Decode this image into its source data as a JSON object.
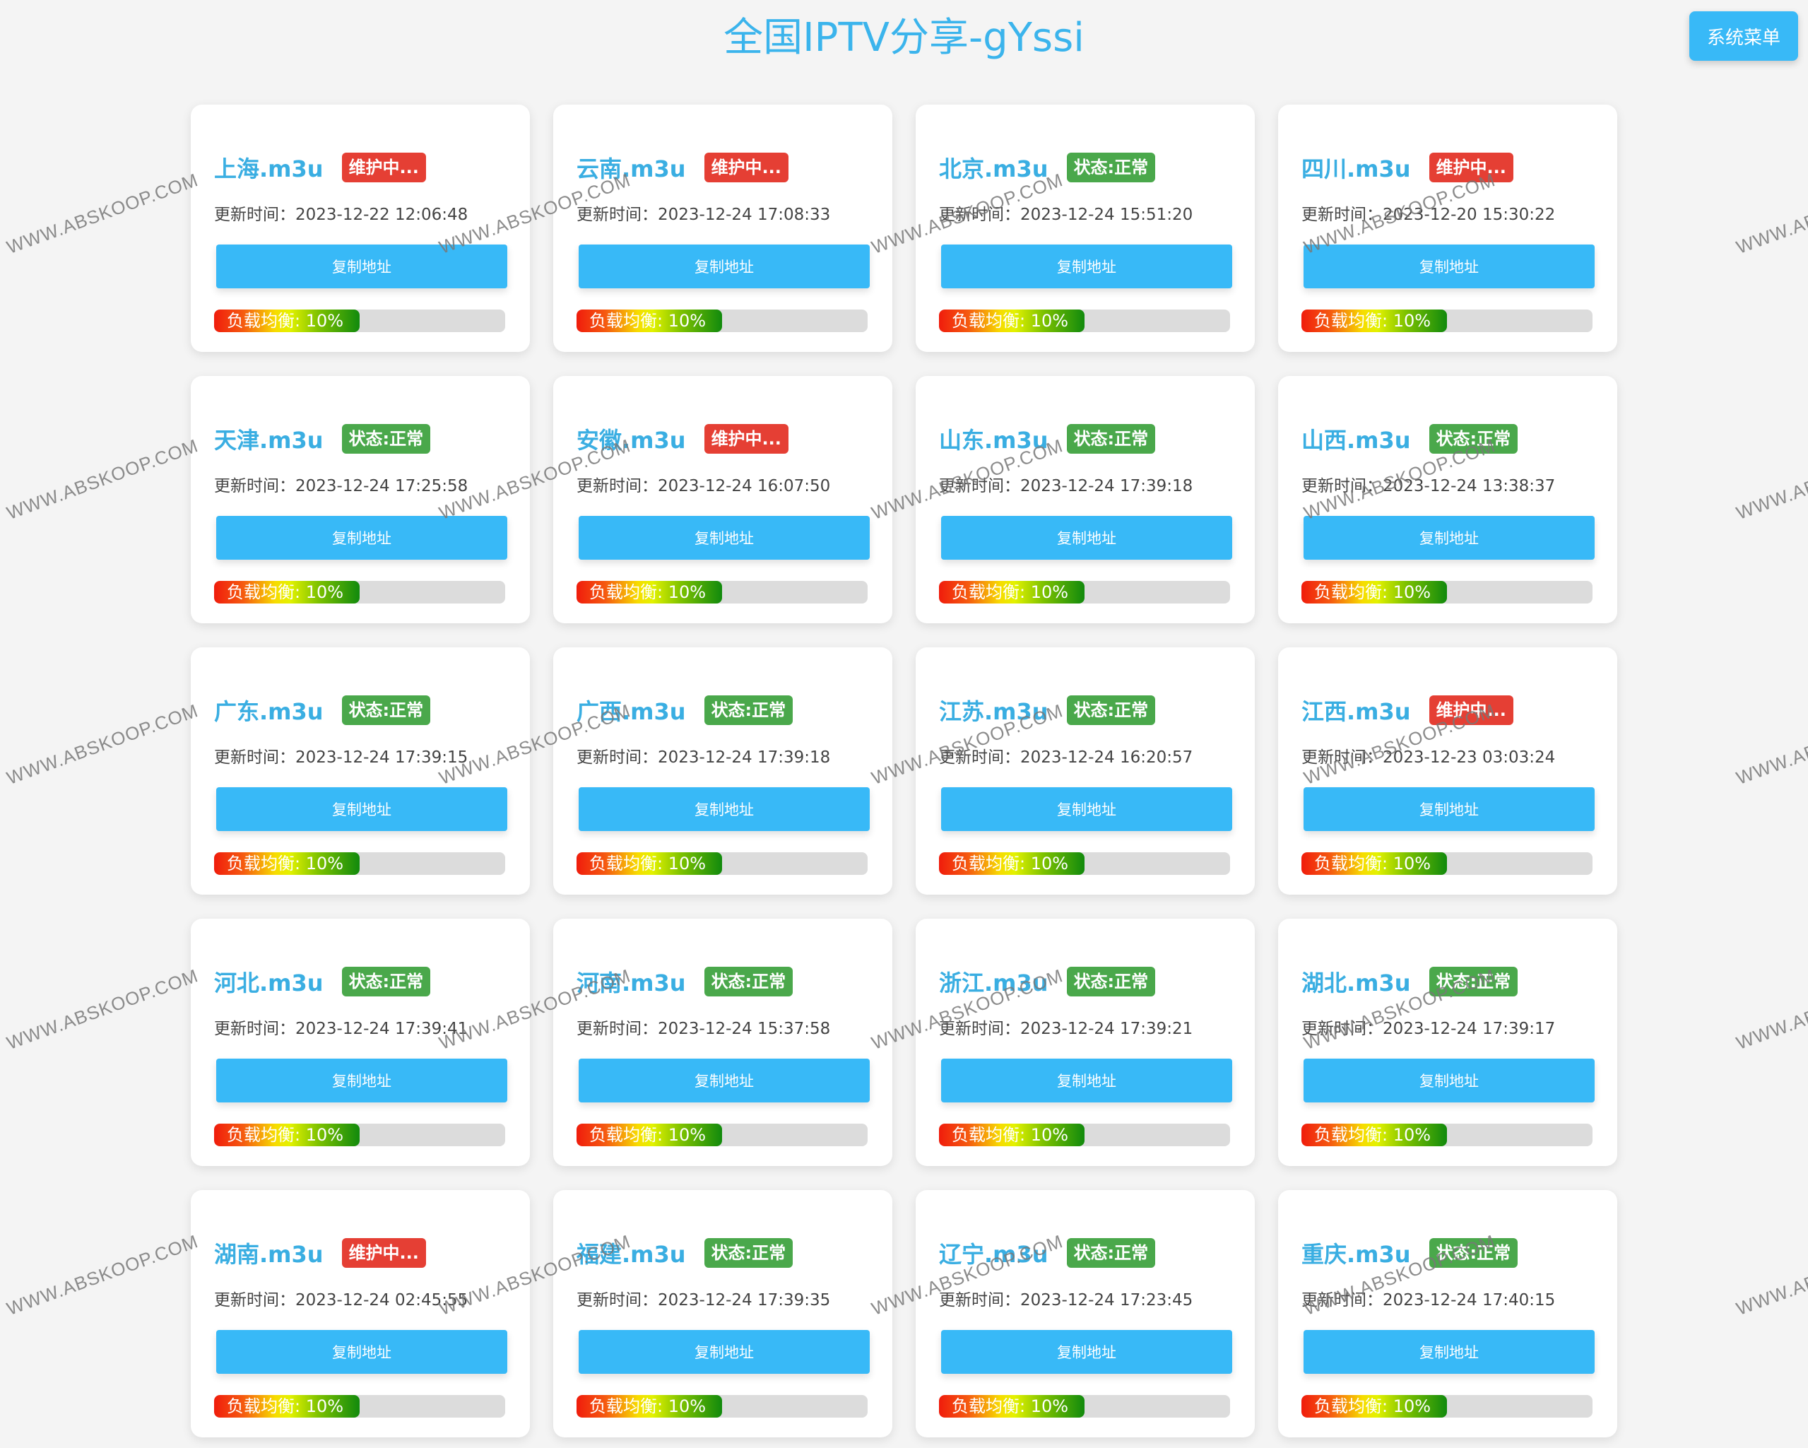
{
  "header": {
    "title": "全国IPTV分享-gYssi",
    "menu_button_label": "系统菜单"
  },
  "card_labels": {
    "time_prefix": "更新时间：",
    "copy_button": "复制地址",
    "load_label": "负载均衡: 10%"
  },
  "status_labels": {
    "ok": "状态:正常",
    "maintenance": "维护中..."
  },
  "colors": {
    "accent": "#38b9f7",
    "title": "#3bb4ec",
    "status_ok": "#4aa84b",
    "status_maintenance": "#e53f34"
  },
  "watermark": "WWW.ABSKOOP.COM",
  "cards": [
    {
      "name": "上海.m3u",
      "status": "maintenance",
      "status_label": "维护中...",
      "updated": "2023-12-22 12:06:48",
      "load_percent": 10
    },
    {
      "name": "云南.m3u",
      "status": "maintenance",
      "status_label": "维护中...",
      "updated": "2023-12-24 17:08:33",
      "load_percent": 10
    },
    {
      "name": "北京.m3u",
      "status": "ok",
      "status_label": "状态:正常",
      "updated": "2023-12-24 15:51:20",
      "load_percent": 10
    },
    {
      "name": "四川.m3u",
      "status": "maintenance",
      "status_label": "维护中...",
      "updated": "2023-12-20 15:30:22",
      "load_percent": 10
    },
    {
      "name": "天津.m3u",
      "status": "ok",
      "status_label": "状态:正常",
      "updated": "2023-12-24 17:25:58",
      "load_percent": 10
    },
    {
      "name": "安徽.m3u",
      "status": "maintenance",
      "status_label": "维护中...",
      "updated": "2023-12-24 16:07:50",
      "load_percent": 10
    },
    {
      "name": "山东.m3u",
      "status": "ok",
      "status_label": "状态:正常",
      "updated": "2023-12-24 17:39:18",
      "load_percent": 10
    },
    {
      "name": "山西.m3u",
      "status": "ok",
      "status_label": "状态:正常",
      "updated": "2023-12-24 13:38:37",
      "load_percent": 10
    },
    {
      "name": "广东.m3u",
      "status": "ok",
      "status_label": "状态:正常",
      "updated": "2023-12-24 17:39:15",
      "load_percent": 10
    },
    {
      "name": "广西.m3u",
      "status": "ok",
      "status_label": "状态:正常",
      "updated": "2023-12-24 17:39:18",
      "load_percent": 10
    },
    {
      "name": "江苏.m3u",
      "status": "ok",
      "status_label": "状态:正常",
      "updated": "2023-12-24 16:20:57",
      "load_percent": 10
    },
    {
      "name": "江西.m3u",
      "status": "maintenance",
      "status_label": "维护中...",
      "updated": "2023-12-23 03:03:24",
      "load_percent": 10
    },
    {
      "name": "河北.m3u",
      "status": "ok",
      "status_label": "状态:正常",
      "updated": "2023-12-24 17:39:41",
      "load_percent": 10
    },
    {
      "name": "河南.m3u",
      "status": "ok",
      "status_label": "状态:正常",
      "updated": "2023-12-24 15:37:58",
      "load_percent": 10
    },
    {
      "name": "浙江.m3u",
      "status": "ok",
      "status_label": "状态:正常",
      "updated": "2023-12-24 17:39:21",
      "load_percent": 10
    },
    {
      "name": "湖北.m3u",
      "status": "ok",
      "status_label": "状态:正常",
      "updated": "2023-12-24 17:39:17",
      "load_percent": 10
    },
    {
      "name": "湖南.m3u",
      "status": "maintenance",
      "status_label": "维护中...",
      "updated": "2023-12-24 02:45:55",
      "load_percent": 10
    },
    {
      "name": "福建.m3u",
      "status": "ok",
      "status_label": "状态:正常",
      "updated": "2023-12-24 17:39:35",
      "load_percent": 10
    },
    {
      "name": "辽宁.m3u",
      "status": "ok",
      "status_label": "状态:正常",
      "updated": "2023-12-24 17:23:45",
      "load_percent": 10
    },
    {
      "name": "重庆.m3u",
      "status": "ok",
      "status_label": "状态:正常",
      "updated": "2023-12-24 17:40:15",
      "load_percent": 10
    }
  ]
}
